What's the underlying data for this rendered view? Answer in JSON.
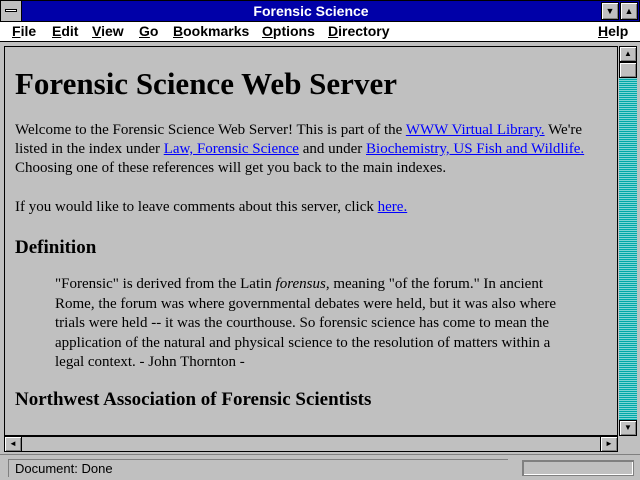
{
  "window": {
    "title": "Forensic Science",
    "minimize_glyph": "▼",
    "maximize_glyph": "▲"
  },
  "menu": {
    "items": [
      {
        "underline": "F",
        "rest": "ile"
      },
      {
        "underline": "E",
        "rest": "dit"
      },
      {
        "underline": "V",
        "rest": "iew"
      },
      {
        "underline": "G",
        "rest": "o"
      },
      {
        "underline": "B",
        "rest": "ookmarks"
      },
      {
        "underline": "O",
        "rest": "ptions"
      },
      {
        "underline": "D",
        "rest": "irectory"
      },
      {
        "underline": "H",
        "rest": "elp"
      }
    ]
  },
  "page": {
    "heading": "Forensic Science Web Server",
    "intro": {
      "t1": "Welcome to the Forensic Science Web Server! This is part of the ",
      "link1": "WWW Virtual Library.",
      "t2": " We're listed in the index under ",
      "link2": "Law, Forensic Science",
      "t3": " and under ",
      "link3": "Biochemistry, US Fish and Wildlife.",
      "t4": " Choosing one of these references will get you back to the main indexes."
    },
    "comments": {
      "t1": "If you would like to leave comments about this server, click ",
      "link": "here."
    },
    "definition_heading": "Definition",
    "definition": {
      "t1": "\"Forensic\" is derived from the Latin ",
      "em": "forensus",
      "t2": ", meaning \"of the forum.\" In ancient Rome, the forum was where governmental debates were held, but it was also where trials were held -- it was the courthouse. So forensic science has come to mean the application of the natural and physical science to the resolution of matters within a legal context. - John Thornton -"
    },
    "section2_heading": "Northwest Association of Forensic Scientists"
  },
  "scrollbars": {
    "up_glyph": "▲",
    "down_glyph": "▼",
    "left_glyph": "◄",
    "right_glyph": "►"
  },
  "status": {
    "text": "Document: Done"
  },
  "colors": {
    "title_bar": "#0000a8",
    "link": "#0000ff",
    "scroll_track": "#00a8a8",
    "background": "#c0c0c0"
  }
}
